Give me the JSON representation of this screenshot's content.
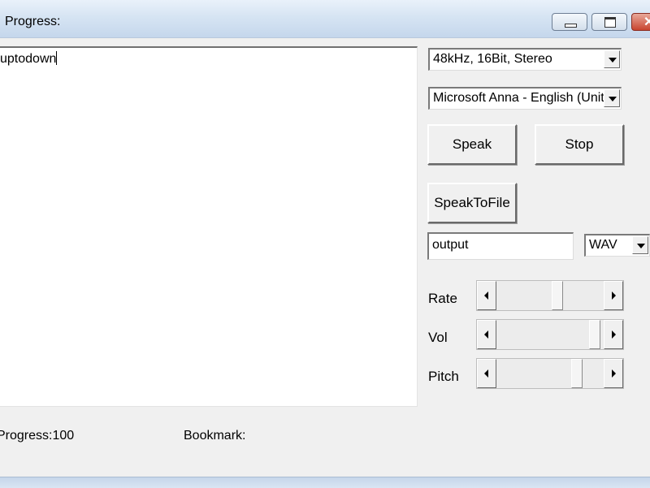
{
  "window": {
    "title": "Progress:",
    "controls": {
      "minimize_icon": "minimize-icon",
      "maximize_icon": "maximize-icon",
      "close_icon": "close-icon",
      "close_glyph": "✕"
    }
  },
  "editor": {
    "text": "uptodown"
  },
  "audio_format": {
    "selected": "48kHz, 16Bit, Stereo"
  },
  "voice": {
    "selected": "Microsoft Anna - English (United States)"
  },
  "buttons": {
    "speak": "Speak",
    "stop": "Stop",
    "speak_to_file": "SpeakToFile"
  },
  "output": {
    "filename": "output",
    "file_type": "WAV"
  },
  "sliders": [
    {
      "label": "Rate",
      "thumb_position": 0.58
    },
    {
      "label": "Vol",
      "thumb_position": 0.97
    },
    {
      "label": "Pitch",
      "thumb_position": 0.78
    }
  ],
  "status": {
    "progress_text": "Progress:100",
    "bookmark_text": "Bookmark:"
  }
}
